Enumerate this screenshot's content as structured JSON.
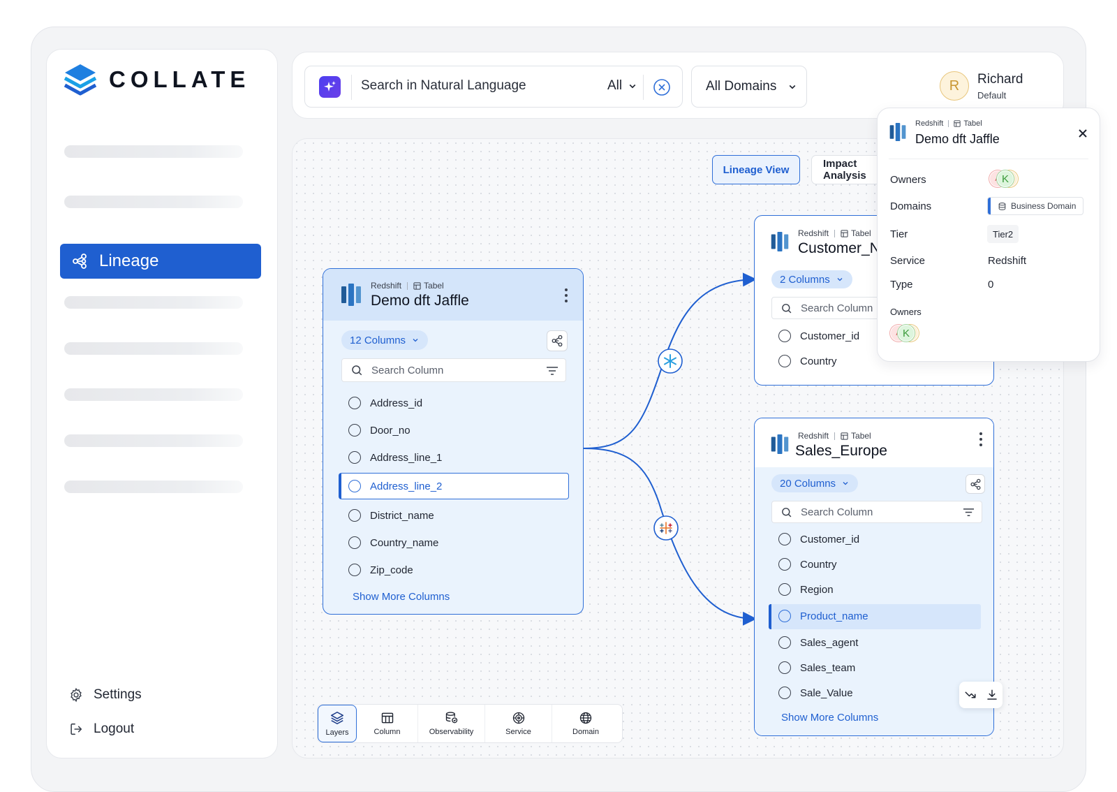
{
  "brand": {
    "name": "COLLATE"
  },
  "sidebar": {
    "active_item": {
      "label": "Lineage",
      "icon": "lineage-icon"
    },
    "bottom": [
      {
        "label": "Settings",
        "icon": "gear-icon"
      },
      {
        "label": "Logout",
        "icon": "logout-icon"
      }
    ]
  },
  "header": {
    "search": {
      "placeholder": "Search in Natural Language",
      "scope": "All"
    },
    "domain_filter": "All Domains",
    "user": {
      "initial": "R",
      "name": "Richard",
      "role": "Default"
    }
  },
  "views": {
    "active": "Lineage View",
    "other": "Impact Analysis"
  },
  "nodes": {
    "source": {
      "service": "Redshift",
      "entity_type": "Tabel",
      "title": "Demo dft Jaffle",
      "column_count": "12 Columns",
      "search_placeholder": "Search Column",
      "columns": [
        "Address_id",
        "Door_no",
        "Address_line_1",
        "Address_line_2",
        "District_name",
        "Country_name",
        "Zip_code"
      ],
      "highlighted_column": "Address_line_2",
      "show_more": "Show More Columns"
    },
    "customer": {
      "service": "Redshift",
      "entity_type": "Tabel",
      "title": "Customer_N",
      "column_count": "2 Columns",
      "search_placeholder": "Search Column",
      "columns": [
        "Customer_id",
        "Country"
      ]
    },
    "sales": {
      "service": "Redshift",
      "entity_type": "Tabel",
      "title": "Sales_Europe",
      "column_count": "20 Columns",
      "search_placeholder": "Search Column",
      "columns": [
        "Customer_id",
        "Country",
        "Region",
        "Product_name",
        "Sales_agent",
        "Sales_team",
        "Sale_Value"
      ],
      "highlighted_column": "Product_name",
      "show_more": "Show More Columns"
    }
  },
  "detail_panel": {
    "service": "Redshift",
    "entity_type": "Tabel",
    "title": "Demo dft Jaffle",
    "owners_label": "Owners",
    "owners": [
      "A",
      "K",
      "R"
    ],
    "domains_label": "Domains",
    "domain_value": "Business Domain",
    "tier_label": "Tier",
    "tier_value": "Tier2",
    "service_label": "Service",
    "service_value": "Redshift",
    "type_label": "Type",
    "type_value": "0",
    "owners_section_label": "Owners"
  },
  "toolbar": {
    "items": [
      {
        "label": "Layers",
        "icon": "layers-icon",
        "active": true
      },
      {
        "label": "Column",
        "icon": "column-icon"
      },
      {
        "label": "Observability",
        "icon": "observability-icon"
      },
      {
        "label": "Service",
        "icon": "service-icon"
      },
      {
        "label": "Domain",
        "icon": "globe-icon"
      }
    ]
  },
  "colors": {
    "accent": "#1f5fd0",
    "node_bg": "#eaf3fd",
    "highlight_bg": "#d6e6fb"
  }
}
